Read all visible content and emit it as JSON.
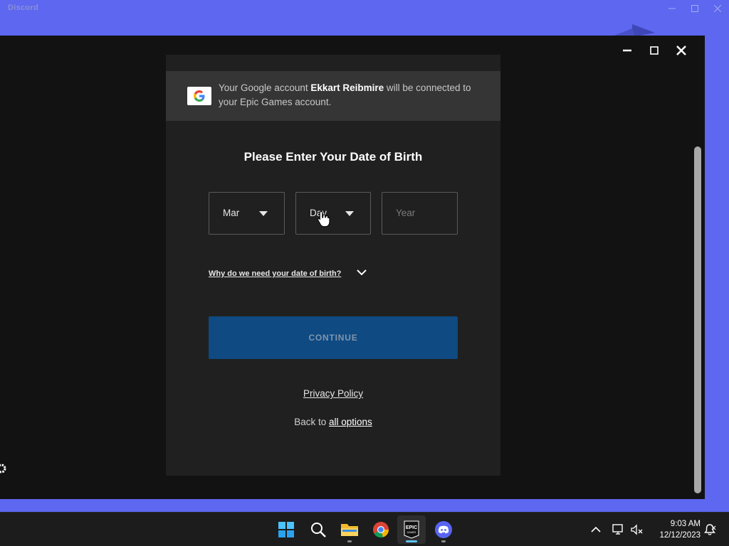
{
  "discord": {
    "title": "Discord",
    "controls": [
      "minimize",
      "maximize",
      "close"
    ]
  },
  "epic": {
    "controls": [
      "minimize",
      "maximize",
      "close"
    ],
    "google_banner": {
      "prefix": "Your Google account ",
      "account_name": "Ekkart Reibmire",
      "suffix": " will be connected to your Epic Games account."
    },
    "title": "Please Enter Your Date of Birth",
    "month": {
      "value": "Mar"
    },
    "day": {
      "value": "Day"
    },
    "year": {
      "placeholder": "Year"
    },
    "why_link": "Why do we need your date of birth?",
    "continue_label": "CONTINUE",
    "privacy_policy": "Privacy Policy",
    "back_prefix": "Back to ",
    "back_link": "all options"
  },
  "taskbar": {
    "apps": [
      {
        "name": "Start",
        "icon": "windows-start-icon",
        "active": false
      },
      {
        "name": "Search",
        "icon": "search-icon",
        "active": false
      },
      {
        "name": "File Explorer",
        "icon": "folder-icon",
        "active": false
      },
      {
        "name": "Google Chrome",
        "icon": "chrome-icon",
        "active": false
      },
      {
        "name": "Epic Games",
        "icon": "epic-games-icon",
        "active": true
      },
      {
        "name": "Discord",
        "icon": "discord-icon",
        "active": false
      }
    ],
    "time": "9:03 AM",
    "date": "12/12/2023"
  },
  "colors": {
    "discord_blurple": "#5d67f0",
    "epic_bg": "#121212",
    "panel_bg": "#202020",
    "banner_bg": "#353535",
    "continue_bg": "#0f4a82",
    "continue_text": "#7f96ad"
  }
}
